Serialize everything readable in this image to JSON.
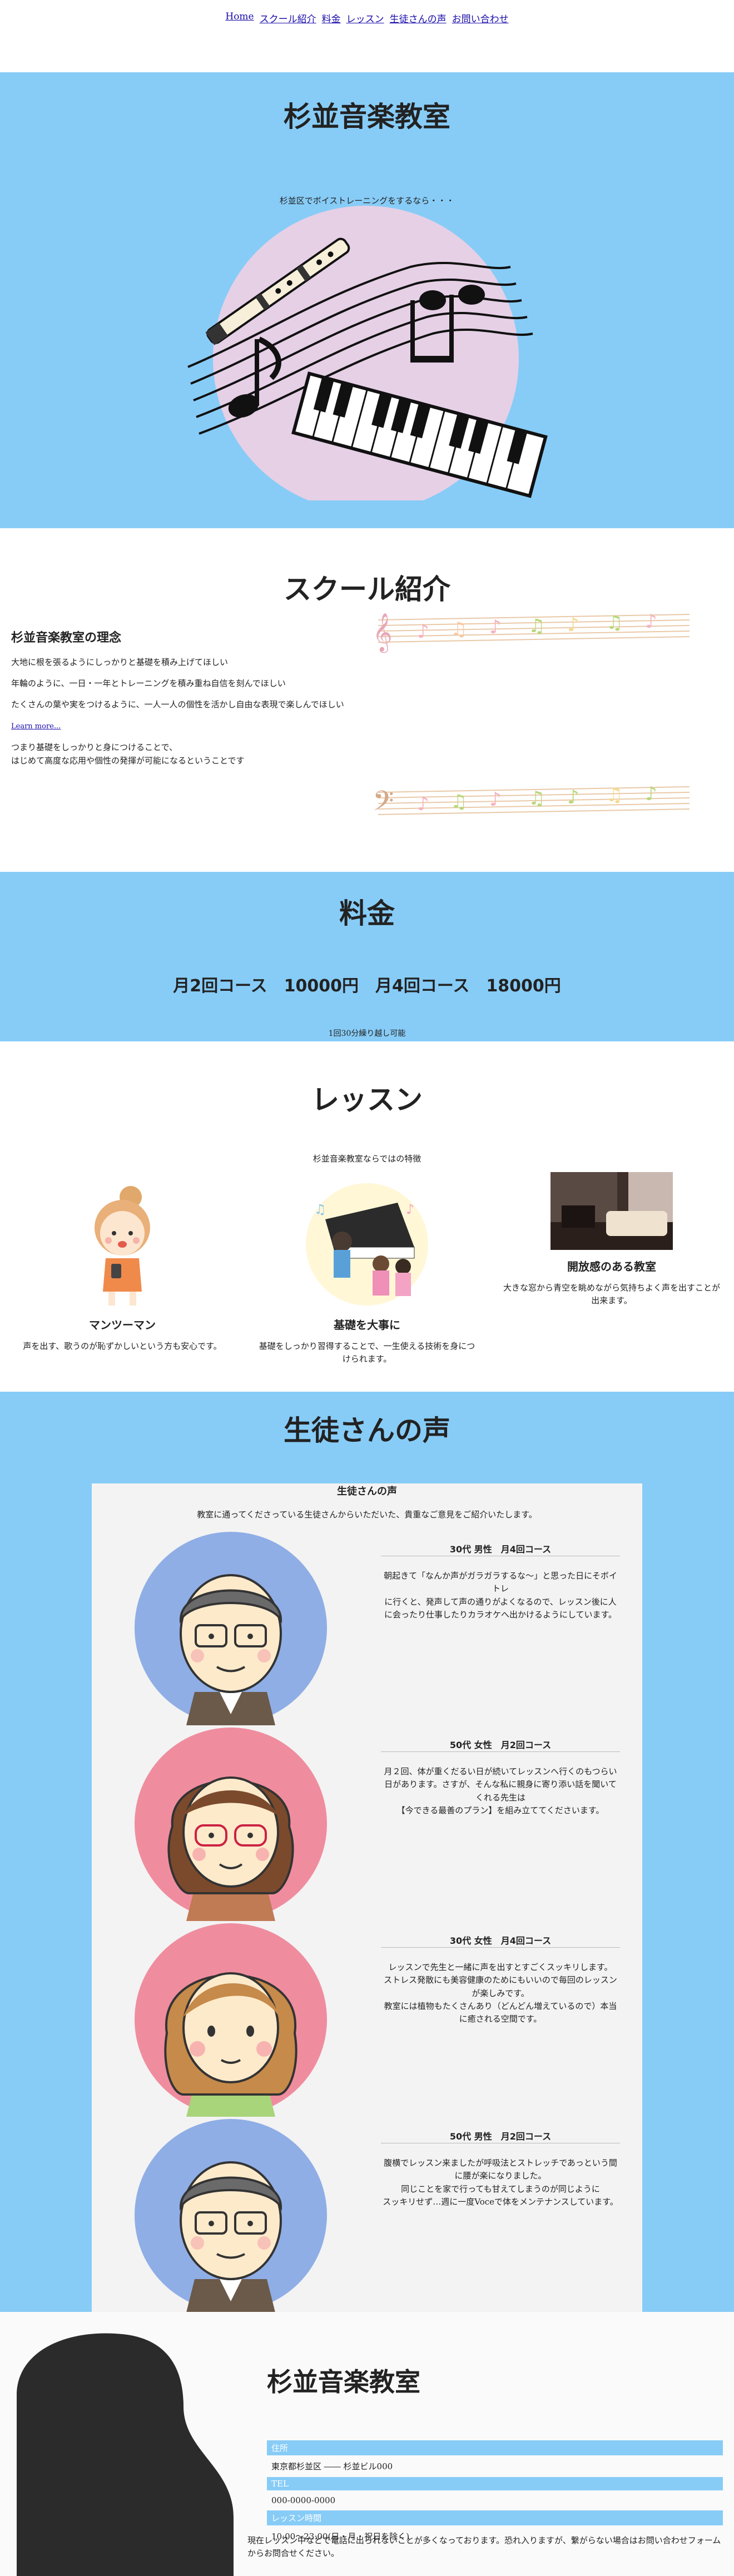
{
  "nav": [
    "Home",
    "スクール紹介",
    "料金",
    "レッスン",
    "生徒さんの声",
    "お問い合わせ"
  ],
  "hero": {
    "title": "杉並音楽教室",
    "subtitle": "杉並区でボイストレーニングをするなら・・・"
  },
  "school": {
    "title": "スクール紹介",
    "philosophy_title": "杉並音楽教室の理念",
    "lines": [
      "大地に根を張るようにしっかりと基礎を積み上げてほしい",
      "年輪のように、一日・一年とトレーニングを積み重ね自信を刻んでほしい",
      "たくさんの葉や実をつけるように、一人一人の個性を活かし自由な表現で楽しんでほしい"
    ],
    "learn_more": "Learn more...",
    "closing": "つまり基礎をしっかりと身につけることで、\nはじめて高度な応用や個性の発揮が可能になるということです"
  },
  "fee": {
    "title": "料金",
    "plans": "月2回コース　10000円　月4回コース　18000円",
    "note": "1回30分繰り越し可能"
  },
  "lesson": {
    "title": "レッスン",
    "subtitle": "杉並音楽教室ならではの特徴",
    "features": [
      {
        "title": "マンツーマン",
        "text": "声を出す、歌うのが恥ずかしいという方も安心です。"
      },
      {
        "title": "基礎を大事に",
        "text": "基礎をしっかり習得することで、一生使える技術を身につけられます。"
      },
      {
        "title": "開放感のある教室",
        "text": "大きな窓から青空を眺めながら気持ちよく声を出すことが出来ます。"
      }
    ]
  },
  "voice": {
    "title": "生徒さんの声",
    "panel_title": "生徒さんの声",
    "intro": "教室に通ってくださっている生徒さんからいただいた、貴重なご意見をご紹介いたします。",
    "reviews": [
      {
        "who": "30代 男性　月4回コース",
        "text": "朝起きて「なんか声がガラガラするな～」と思った日にそボイトレ\nに行くと、発声して声の通りがよくなるので、レッスン後に人に会ったり仕事したりカラオケへ出かけるようにしています。",
        "face": "man"
      },
      {
        "who": "50代 女性　月2回コース",
        "text": "月２回、体が重くだるい日が続いてレッスンへ行くのもつらい日があります。さすが、そんな私に親身に寄り添い話を聞いてくれる先生は\n【今できる最善のプラン】を組み立ててくださいます。",
        "face": "woman-glasses"
      },
      {
        "who": "30代 女性　月4回コース",
        "text": "レッスンで先生と一緒に声を出すとすごくスッキリします。\nストレス発散にも美容健康のためにもいいので毎回のレッスンが楽しみです。\n教室には植物もたくさんあり（どんどん増えているので）本当に癒される空間です。",
        "face": "woman"
      },
      {
        "who": "50代 男性　月2回コース",
        "text": "腹横でレッスン来ましたが呼吸法とストレッチであっという間に腰が楽になりました。\n同じことを家で行っても甘えてしまうのが同じように\nスッキリせず…週に一度Voceで体をメンテナンスしています。",
        "face": "man2"
      }
    ]
  },
  "footer": {
    "title": "杉並音楽教室",
    "address_label": "住所",
    "address": "東京都杉並区 ―― 杉並ビル000",
    "tel_label": "TEL",
    "tel": "000-0000-0000",
    "hours_label": "レッスン時間",
    "hours": "10:00～23:00(日・月・祝日を除く)",
    "message": "現在レッスン中などで電話に出られないことが多くなっております。恐れ入りますが、繋がらない場合はお問い合わせフォームからお問合せください。"
  },
  "colors": {
    "accent": "#87ccf7",
    "panel": "#f3f3f3"
  }
}
